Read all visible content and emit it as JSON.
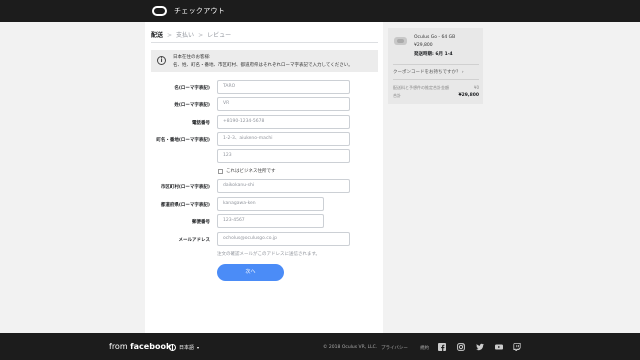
{
  "header": {
    "title": "チェックアウト",
    "logo_icon": "oculus-logo-icon"
  },
  "steps": {
    "items": [
      "配送",
      "支払い",
      "レビュー"
    ],
    "separator": ">"
  },
  "notice": {
    "line1": "日本在住のお客様:",
    "line2": "名、姓、町名・番地、市区町村、都道府県はそれぞれローマ字表記で入力してください。"
  },
  "form": {
    "first_name": {
      "label": "名(ローマ字表記)",
      "value": "TARO"
    },
    "last_name": {
      "label": "姓(ローマ字表記)",
      "value": "VR"
    },
    "phone": {
      "label": "電話番号",
      "value": "+8190-1234-5678"
    },
    "street": {
      "label": "町名・番地(ローマ字表記)",
      "value": "1-2-3、aiukeno-machi"
    },
    "street2": {
      "value": "123"
    },
    "business_checkbox": {
      "label": "これはビジネス住所です",
      "checked": false
    },
    "city": {
      "label": "市区町村(ローマ字表記)",
      "value": "daikokanu-shi"
    },
    "prefecture": {
      "label": "都道府県(ローマ字表記)",
      "value": "kanagawa-ken"
    },
    "postal": {
      "label": "郵便番号",
      "value": "123-4567"
    },
    "email": {
      "label": "メールアドレス",
      "value": "ocholus@oculusgo.co.jp"
    },
    "email_hint": "注文の確認メールがこのアドレスに送信されます。",
    "next_label": "次へ"
  },
  "cart": {
    "product_name": "Oculus Go - 64 GB",
    "price": "¥29,800",
    "ship_date": "発送時期: 6月 1-4",
    "coupon_label": "クーポンコードをお持ちですか？ ›",
    "tax_label": "配送料と予想件の推定合計金額",
    "tax_value": "¥0",
    "total_label": "合計",
    "total_value": "¥29,800"
  },
  "footer": {
    "brand_prefix": "from",
    "brand_name": "facebook",
    "language": "日本語",
    "copyright": "© 2018 Oculus VR, LLC.",
    "links": [
      "プライバシー",
      "規約"
    ],
    "social_icons": [
      "facebook-icon",
      "instagram-icon",
      "twitter-icon",
      "youtube-icon",
      "twitch-icon"
    ]
  },
  "colors": {
    "accent": "#4b8cf7",
    "bar": "#1c1c1c",
    "background": "#f2f2f2"
  }
}
